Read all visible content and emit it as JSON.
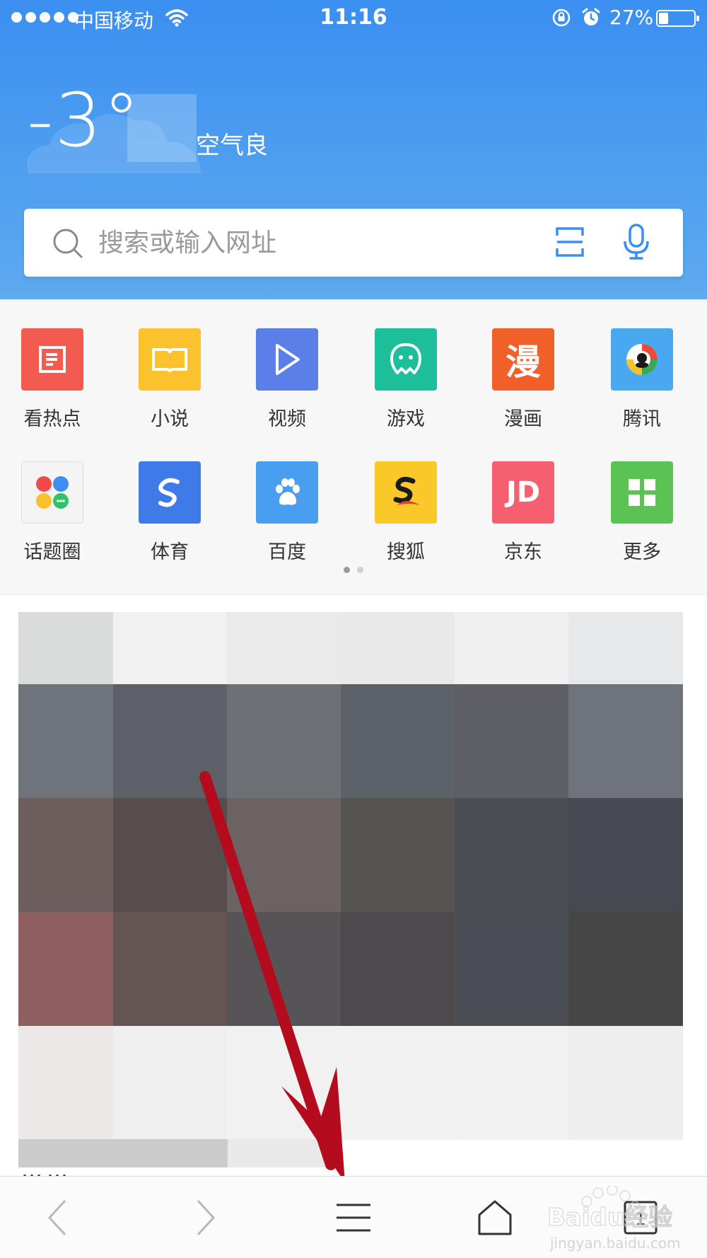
{
  "status_bar": {
    "carrier": "中国移动",
    "time": "11:16",
    "battery_percent": "27%",
    "battery_level": 0.27
  },
  "weather": {
    "temperature": "-3°",
    "air_quality": "空气良"
  },
  "search": {
    "placeholder": "搜索或输入网址"
  },
  "grid": {
    "items": [
      {
        "label": "看热点",
        "icon": "hot-news-icon",
        "color": "#f45b4f"
      },
      {
        "label": "小说",
        "icon": "book-icon",
        "color": "#fcc22e"
      },
      {
        "label": "视频",
        "icon": "play-icon",
        "color": "#5b7fe8"
      },
      {
        "label": "游戏",
        "icon": "game-icon",
        "color": "#1dbf9a"
      },
      {
        "label": "漫画",
        "icon": "comic-icon",
        "color": "#f2602a",
        "glyph": "漫"
      },
      {
        "label": "腾讯",
        "icon": "tencent-icon",
        "color": "#49a8f0"
      },
      {
        "label": "话题圈",
        "icon": "topic-circle-icon",
        "color": "#f4f4f4"
      },
      {
        "label": "体育",
        "icon": "sports-icon",
        "color": "#3e7be8"
      },
      {
        "label": "百度",
        "icon": "baidu-paw-icon",
        "color": "#4a9ef0"
      },
      {
        "label": "搜狐",
        "icon": "sohu-icon",
        "color": "#fbc82a"
      },
      {
        "label": "京东",
        "icon": "jd-icon",
        "color": "#f65f6f",
        "glyph": "JD"
      },
      {
        "label": "更多",
        "icon": "more-apps-icon",
        "color": "#5bc254"
      }
    ],
    "page_dots": {
      "count": 2,
      "active": 0
    }
  },
  "feed": {
    "partial_text": "……"
  },
  "toolbar": {
    "items": [
      {
        "icon": "back-icon"
      },
      {
        "icon": "forward-icon"
      },
      {
        "icon": "menu-icon"
      },
      {
        "icon": "home-icon"
      },
      {
        "icon": "tabs-icon",
        "count": "1"
      }
    ]
  },
  "watermark": {
    "brand": "Baidu经验",
    "url": "jingyan.baidu.com"
  },
  "colors": {
    "header_top": "#3a8ff0",
    "header_bottom": "#5eaaf0",
    "arrow": "#b50b1e"
  }
}
